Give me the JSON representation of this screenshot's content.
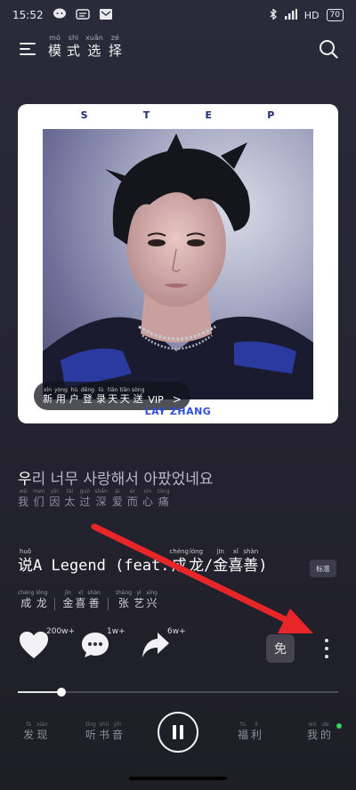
{
  "status": {
    "time": "15:52",
    "network": "HD",
    "battery": "70"
  },
  "header": {
    "title": [
      {
        "py": "mó",
        "hz": "模"
      },
      {
        "py": "shì",
        "hz": "式"
      },
      {
        "py": "xuǎn",
        "hz": "选"
      },
      {
        "py": "zé",
        "hz": "择"
      }
    ]
  },
  "cover": {
    "letters": [
      "S",
      "T",
      "E",
      "P"
    ],
    "artist_logo": "LAY ZHANG",
    "vip_pill": {
      "chars": [
        {
          "py": "xīn",
          "hz": "新"
        },
        {
          "py": "yòng",
          "hz": "用"
        },
        {
          "py": "hù",
          "hz": "户"
        },
        {
          "py": "dēng",
          "hz": "登"
        },
        {
          "py": "lù",
          "hz": "录"
        },
        {
          "py": "tiān",
          "hz": "天"
        },
        {
          "py": "tiān",
          "hz": "天"
        },
        {
          "py": "sòng",
          "hz": "送"
        }
      ],
      "suffix": "VIP",
      "chevron": ">"
    }
  },
  "lyric": {
    "highlight": "우",
    "rest": "리 너무 사랑해서 아팠었네요",
    "translation": [
      {
        "py": "wǒ",
        "hz": "我"
      },
      {
        "py": "men",
        "hz": "们"
      },
      {
        "py": "yīn",
        "hz": "因"
      },
      {
        "py": "tài",
        "hz": "太"
      },
      {
        "py": "guò",
        "hz": "过"
      },
      {
        "py": "shēn",
        "hz": "深"
      },
      {
        "py": "ài",
        "hz": "爱"
      },
      {
        "py": "ér",
        "hz": "而"
      },
      {
        "py": "xīn",
        "hz": "心"
      },
      {
        "py": "tòng",
        "hz": "痛"
      }
    ]
  },
  "song": {
    "first_char": {
      "py": "huǒ",
      "hz": "说"
    },
    "title_text": "A Legend (feat.",
    "ft_chars": [
      {
        "py": "chéng",
        "hz": "成"
      },
      {
        "py": "lóng",
        "hz": "龙"
      }
    ],
    "slash": "/",
    "ft2_chars": [
      {
        "py": "jīn",
        "hz": "金"
      },
      {
        "py": "xǐ",
        "hz": "喜"
      },
      {
        "py": "shàn",
        "hz": "善"
      }
    ],
    "close": ")",
    "quality": "标准"
  },
  "artists": [
    [
      {
        "py": "chéng",
        "hz": "成"
      },
      {
        "py": "lóng",
        "hz": "龙"
      }
    ],
    [
      {
        "py": "jīn",
        "hz": "金"
      },
      {
        "py": "xǐ",
        "hz": "喜"
      },
      {
        "py": "shàn",
        "hz": "善"
      }
    ],
    [
      {
        "py": "zhāng",
        "hz": "张"
      },
      {
        "py": "yì",
        "hz": "艺"
      },
      {
        "py": "xīng",
        "hz": "兴"
      }
    ]
  ],
  "actions": {
    "like_count": "200w+",
    "comment_count": "1w+",
    "share_count": "6w+",
    "free_label": "免"
  },
  "progress": {
    "fraction": 0.135
  },
  "nav": {
    "discover": [
      {
        "py": "fā",
        "hz": "发"
      },
      {
        "py": "xiàn",
        "hz": "现"
      }
    ],
    "listen": [
      {
        "py": "tīng",
        "hz": "听"
      },
      {
        "py": "shū",
        "hz": "书"
      },
      {
        "py": "yīn",
        "hz": "音"
      }
    ],
    "welfare": [
      {
        "py": "fú",
        "hz": "福"
      },
      {
        "py": "lì",
        "hz": "利"
      }
    ],
    "mine": [
      {
        "py": "wǒ",
        "hz": "我"
      },
      {
        "py": "de",
        "hz": "的"
      }
    ]
  },
  "colors": {
    "accent_arrow": "#e8262a",
    "online_dot": "#38d15e",
    "artist_logo": "#2f4ee0"
  }
}
